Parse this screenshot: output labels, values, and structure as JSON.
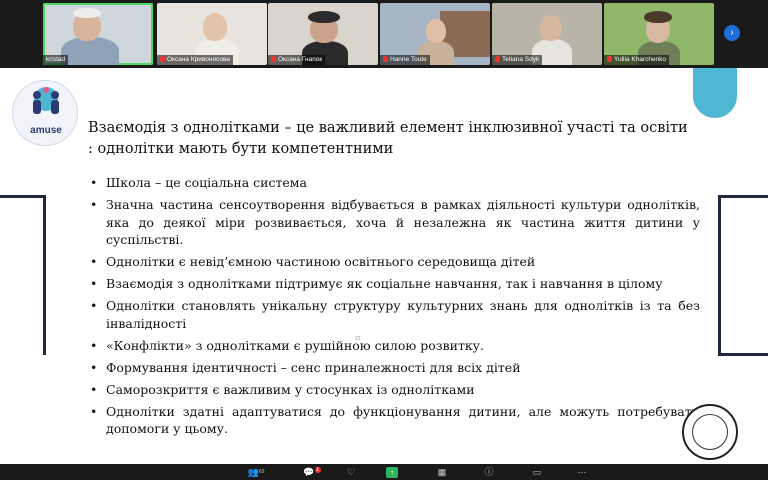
{
  "meeting": {
    "participants": [
      {
        "name": "kristad",
        "muted": false,
        "active": true
      },
      {
        "name": "Оксана Кривоносова",
        "muted": true,
        "active": false
      },
      {
        "name": "Оксана Гнапок",
        "muted": true,
        "active": false
      },
      {
        "name": "Hanne Toute",
        "muted": true,
        "active": false
      },
      {
        "name": "Tetiana Sdyk",
        "muted": true,
        "active": false
      },
      {
        "name": "Yuliia Kharchenko",
        "muted": true,
        "active": false
      }
    ],
    "next_page_icon": "chevron-right-icon",
    "toolbar": {
      "participants_count": "69",
      "chat_badge": "1"
    }
  },
  "slide": {
    "logo_text": "amuse",
    "title": "Взаємодія з однолітками – це важливий елемент інклюзивної участі та освіти : однолітки мають бути компетентними",
    "bullets": [
      "Школа – це соціальна система",
      "Значна частина сенсоутворення відбувається в рамках діяльності культури однолітків, яка до деякої міри розвивається, хоча й незалежна як частина життя дитини у суспільстві.",
      "Однолітки є невід’ємною частиною освітнього середовища дітей",
      "Взаємодія з однолітками підтримує як соціальне навчання, так і навчання в цілому",
      "Однолітки становлять унікальну структуру культурних знань для однолітків із та без інвалідності",
      "«Конфлікти» з однолітками є рушійною силою розвитку.",
      "Формування ідентичності – сенс приналежності для всіх дітей",
      "Саморозкриття є важливим у стосунках із однолітками",
      "Однолітки здатні адаптуватися до функціонування дитини, але можуть потребувати допомоги у цьому."
    ],
    "page_number": "22",
    "colors": {
      "accent": "#4fb6d3",
      "line": "#1e2a3c",
      "text": "#111111"
    }
  }
}
